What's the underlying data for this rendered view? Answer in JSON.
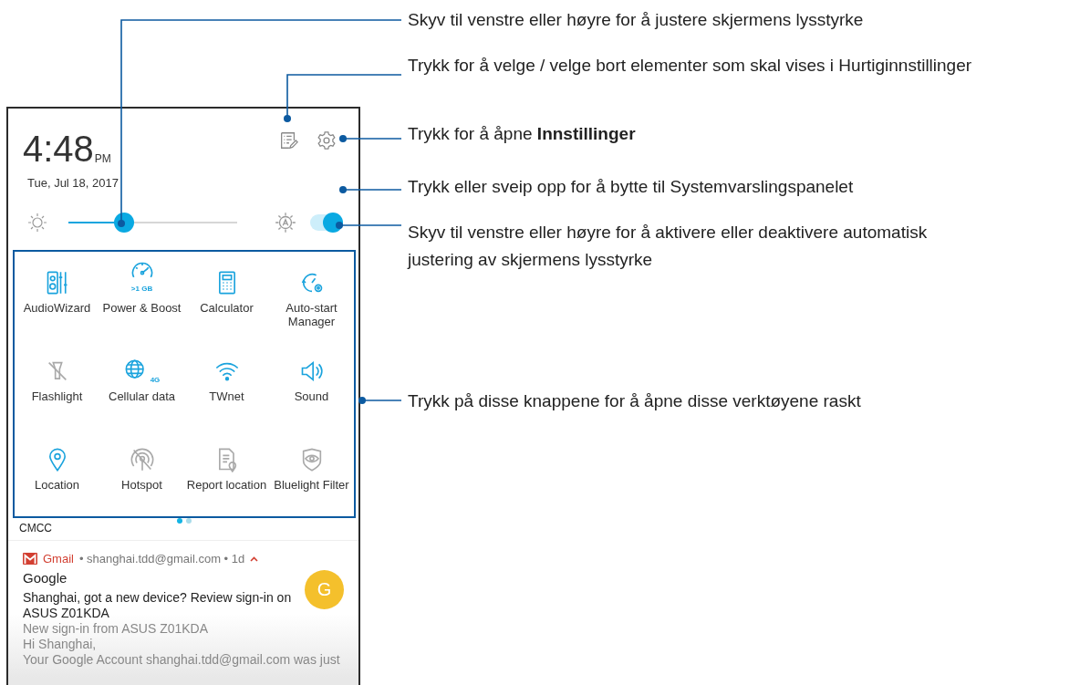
{
  "callouts": [
    {
      "text": "Skyv til venstre eller høyre for å justere skjermens lysstyrke"
    },
    {
      "text": "Trykk for å velge / velge bort elementer som skal vises i Hurtiginnstillinger"
    },
    {
      "text": "Trykk for å åpne **Innstillinger**"
    },
    {
      "text": "Trykk eller sveip opp for å bytte til Systemvarslingspanelet"
    },
    {
      "text": "Skyv til venstre eller høyre for å aktivere eller deaktivere automatisk justering av skjermens lysstyrke"
    },
    {
      "text": "Trykk på disse knappene for å åpne disse verktøyene raskt"
    }
  ],
  "clock": {
    "time": "4:48",
    "ampm": "PM",
    "date": "Tue, Jul 18, 2017"
  },
  "brightness": {
    "level": 0.33,
    "auto_on": true
  },
  "tiles": [
    {
      "label": "AudioWizard",
      "on": true
    },
    {
      "label": "Power & Boost",
      "on": true,
      "badge": ">1 GB"
    },
    {
      "label": "Calculator",
      "on": true
    },
    {
      "label": "Auto-start Manager",
      "on": true
    },
    {
      "label": "Flashlight",
      "on": false
    },
    {
      "label": "Cellular data",
      "on": true,
      "badge": "4G"
    },
    {
      "label": "TWnet",
      "on": true
    },
    {
      "label": "Sound",
      "on": true
    },
    {
      "label": "Location",
      "on": true
    },
    {
      "label": "Hotspot",
      "on": false
    },
    {
      "label": "Report location",
      "on": false
    },
    {
      "label": "Bluelight Filter",
      "on": false
    }
  ],
  "page_dots": [
    {
      "selected": true
    },
    {
      "selected": false
    }
  ],
  "carrier": "CMCC",
  "notification": {
    "app": "Gmail",
    "meta": "• shanghai.tdd@gmail.com • 1d",
    "avatar": "G",
    "title": "Google",
    "subject": "Shanghai, got a new device? Review sign-in on ASUS Z01KDA",
    "lines": [
      "New sign-in from ASUS Z01KDA",
      "Hi Shanghai,",
      "Your Google Account shanghai.tdd@gmail.com was just"
    ]
  }
}
